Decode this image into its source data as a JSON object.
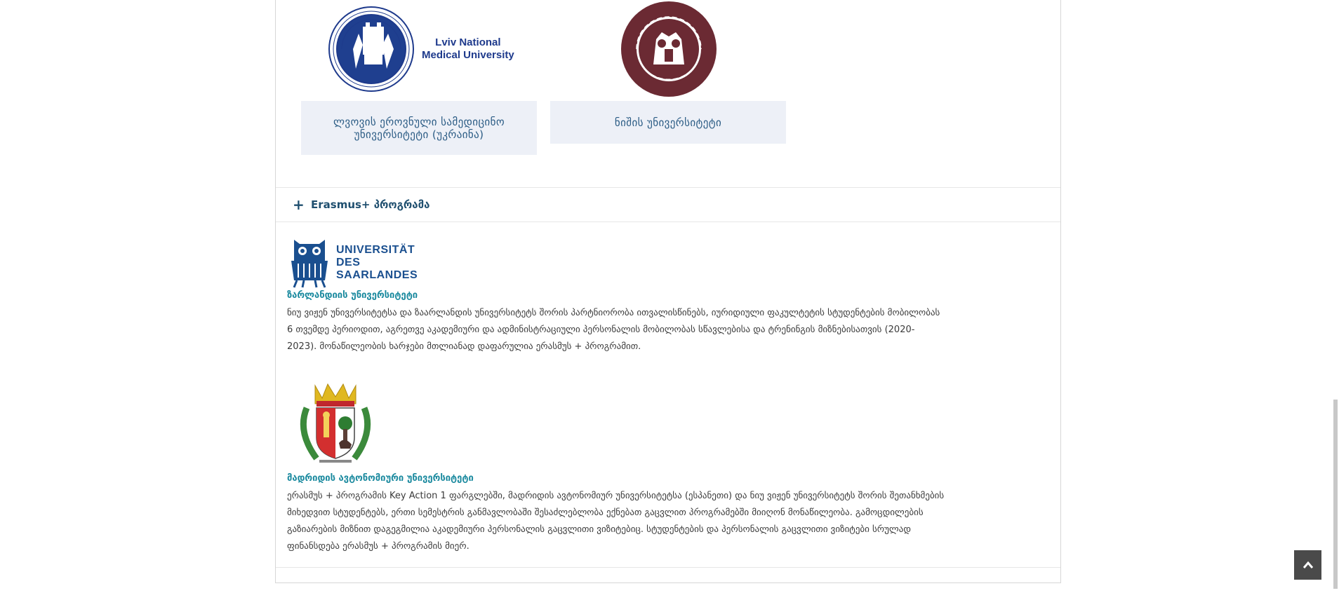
{
  "universities": [
    {
      "caption": "ლვოვის ეროვნული სამედიცინო უნივერსიტეტი (უკრაინა)",
      "logo_text_line1": "Lviv National",
      "logo_text_line2": "Medical University",
      "logo_icon": "lviv-university-seal"
    },
    {
      "caption": "ნიშის უნივერსიტეტი",
      "logo_icon": "nis-university-seal"
    }
  ],
  "accordion": {
    "icon": "plus-icon",
    "title": "Erasmus+ პროგრამა"
  },
  "partners": [
    {
      "logo_line1": "UNIVERSITÄT",
      "logo_line2": "DES",
      "logo_line3": "SAARLANDES",
      "name": "ზარლანდიის უნივერსიტეტი",
      "desc_lines": [
        "ნიუ ვიჟენ უნივერსიტეტსა და ზაარლანდის უნივერსიტეტს შორის პარტნიორობა ითვალისწინებს, იურიდიული ფაკულტეტის სტუდენტების მობილობას",
        "6 თვემდე პერიოდით, აგრეთვე აკადემიური და ადმინისტრაციული პერსონალის მობილობას სწავლებისა და ტრენინგის მიზნებისათვის (2020-",
        "2023). მონაწილეობის ხარჯები მთლიანად დაფარულია ერასმუს + პროგრამით."
      ]
    },
    {
      "name": "მადრიდის ავტონომიური უნივერსიტეტი",
      "desc_lines": [
        "ერასმუს + პროგრამის Key Action 1 ფარგლებში, მადრიდის ავტონომიურ უნივერსიტეტსა (ესპანეთი) და ნიუ ვიჟენ უნივერსიტეტს შორის შეთანხმების",
        "მიხედვით სტუდენტებს, ერთი სემესტრის განმავლობაში შესაძლებლობა ექნებათ გაცვლით პროგრამებში მიიღონ მონაწილეობა. გამოცდილების",
        "გაზიარების მიზნით დაგეგმილია აკადემიური პერსონალის გაცვლითი ვიზიტებიც. სტუდენტების და პერსონალის გაცვლითი ვიზიტები სრულად",
        "ფინანსდება ერასმუს + პროგრამის მიერ."
      ]
    }
  ],
  "colors": {
    "caption_bg": "#edf0f7",
    "caption_text": "#2a5b84",
    "accordion_text": "#1f4f6f",
    "partner_name": "#1b8a9f"
  }
}
